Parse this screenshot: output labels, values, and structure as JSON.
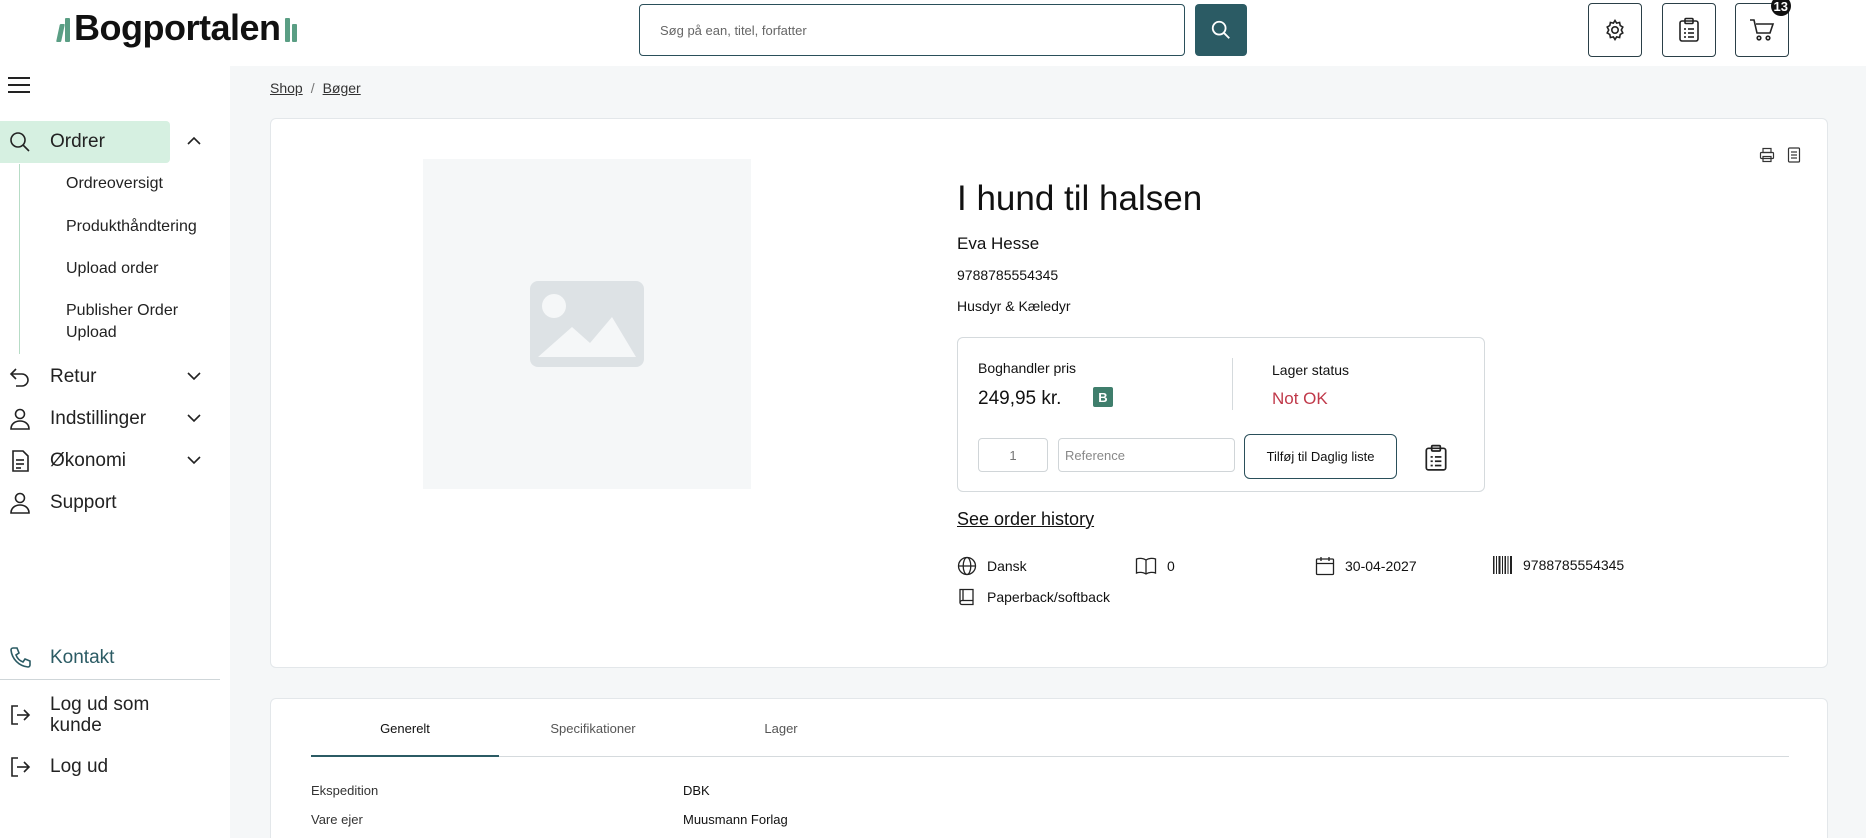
{
  "header": {
    "logo_text": "Bogportalen",
    "search_placeholder": "Søg på ean, titel, forfatter",
    "cart_count": "13"
  },
  "sidebar": {
    "items": [
      {
        "label": "Ordrer",
        "icon": "search-icon",
        "expanded": true
      },
      {
        "label": "Retur",
        "icon": "return-icon"
      },
      {
        "label": "Indstillinger",
        "icon": "user-icon"
      },
      {
        "label": "Økonomi",
        "icon": "document-icon"
      },
      {
        "label": "Support",
        "icon": "user-icon"
      }
    ],
    "sub_items": [
      "Ordreoversigt",
      "Produkthåndtering",
      "Upload order",
      "Publisher Order Upload"
    ],
    "kontakt": "Kontakt",
    "logout_customer": "Log ud som kunde",
    "logout": "Log ud"
  },
  "breadcrumb": [
    "Shop",
    "Bøger"
  ],
  "product": {
    "title": "I hund til halsen",
    "author": "Eva Hesse",
    "isbn": "9788785554345",
    "category": "Husdyr & Kæledyr",
    "price_label": "Boghandler pris",
    "price": "249,95 kr.",
    "price_badge": "B",
    "stock_label": "Lager status",
    "stock_status": "Not OK",
    "qty_placeholder": "1",
    "reference_placeholder": "Reference",
    "add_button": "Tilføj til Daglig liste",
    "order_history": "See order history",
    "language": "Dansk",
    "pages": "0",
    "date": "30-04-2027",
    "barcode": "9788785554345",
    "format": "Paperback/softback"
  },
  "tabs": [
    "Generelt",
    "Specifikationer",
    "Lager"
  ],
  "specs": [
    {
      "label": "Ekspedition",
      "value": "DBK"
    },
    {
      "label": "Vare ejer",
      "value": "Muusmann Forlag"
    }
  ],
  "colors": {
    "accent": "#2b5b64",
    "active_nav": "#d6f0e1",
    "status_bad": "#c0394a",
    "badge": "#3f7e6c"
  }
}
